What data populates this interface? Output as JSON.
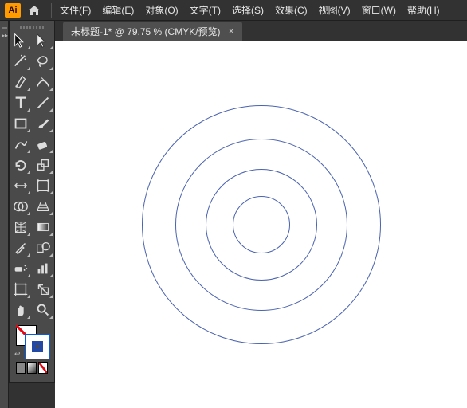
{
  "menubar": {
    "items": [
      {
        "label": "文件(F)"
      },
      {
        "label": "编辑(E)"
      },
      {
        "label": "对象(O)"
      },
      {
        "label": "文字(T)"
      },
      {
        "label": "选择(S)"
      },
      {
        "label": "效果(C)"
      },
      {
        "label": "视图(V)"
      },
      {
        "label": "窗口(W)"
      },
      {
        "label": "帮助(H)"
      }
    ]
  },
  "tab": {
    "title": "未标题-1* @ 79.75 % (CMYK/预览)",
    "close_glyph": "×"
  },
  "ai_badge": "Ai",
  "tools": [
    [
      "selection",
      "direct-selection"
    ],
    [
      "magic-wand",
      "lasso"
    ],
    [
      "pen",
      "curvature"
    ],
    [
      "type",
      "line-segment"
    ],
    [
      "rectangle",
      "paintbrush"
    ],
    [
      "shaper",
      "eraser"
    ],
    [
      "rotate",
      "scale"
    ],
    [
      "width",
      "free-transform"
    ],
    [
      "shape-builder",
      "perspective-grid"
    ],
    [
      "mesh",
      "gradient"
    ],
    [
      "eyedropper",
      "blend"
    ],
    [
      "symbol-sprayer",
      "column-graph"
    ],
    [
      "artboard",
      "slice"
    ],
    [
      "hand",
      "zoom"
    ]
  ],
  "chart_data": {
    "type": "concentric-circles",
    "rings": [
      {
        "diameter": 300
      },
      {
        "diameter": 216
      },
      {
        "diameter": 140
      },
      {
        "diameter": 72
      }
    ],
    "stroke_color": "#4a63b0",
    "fill": "none"
  }
}
